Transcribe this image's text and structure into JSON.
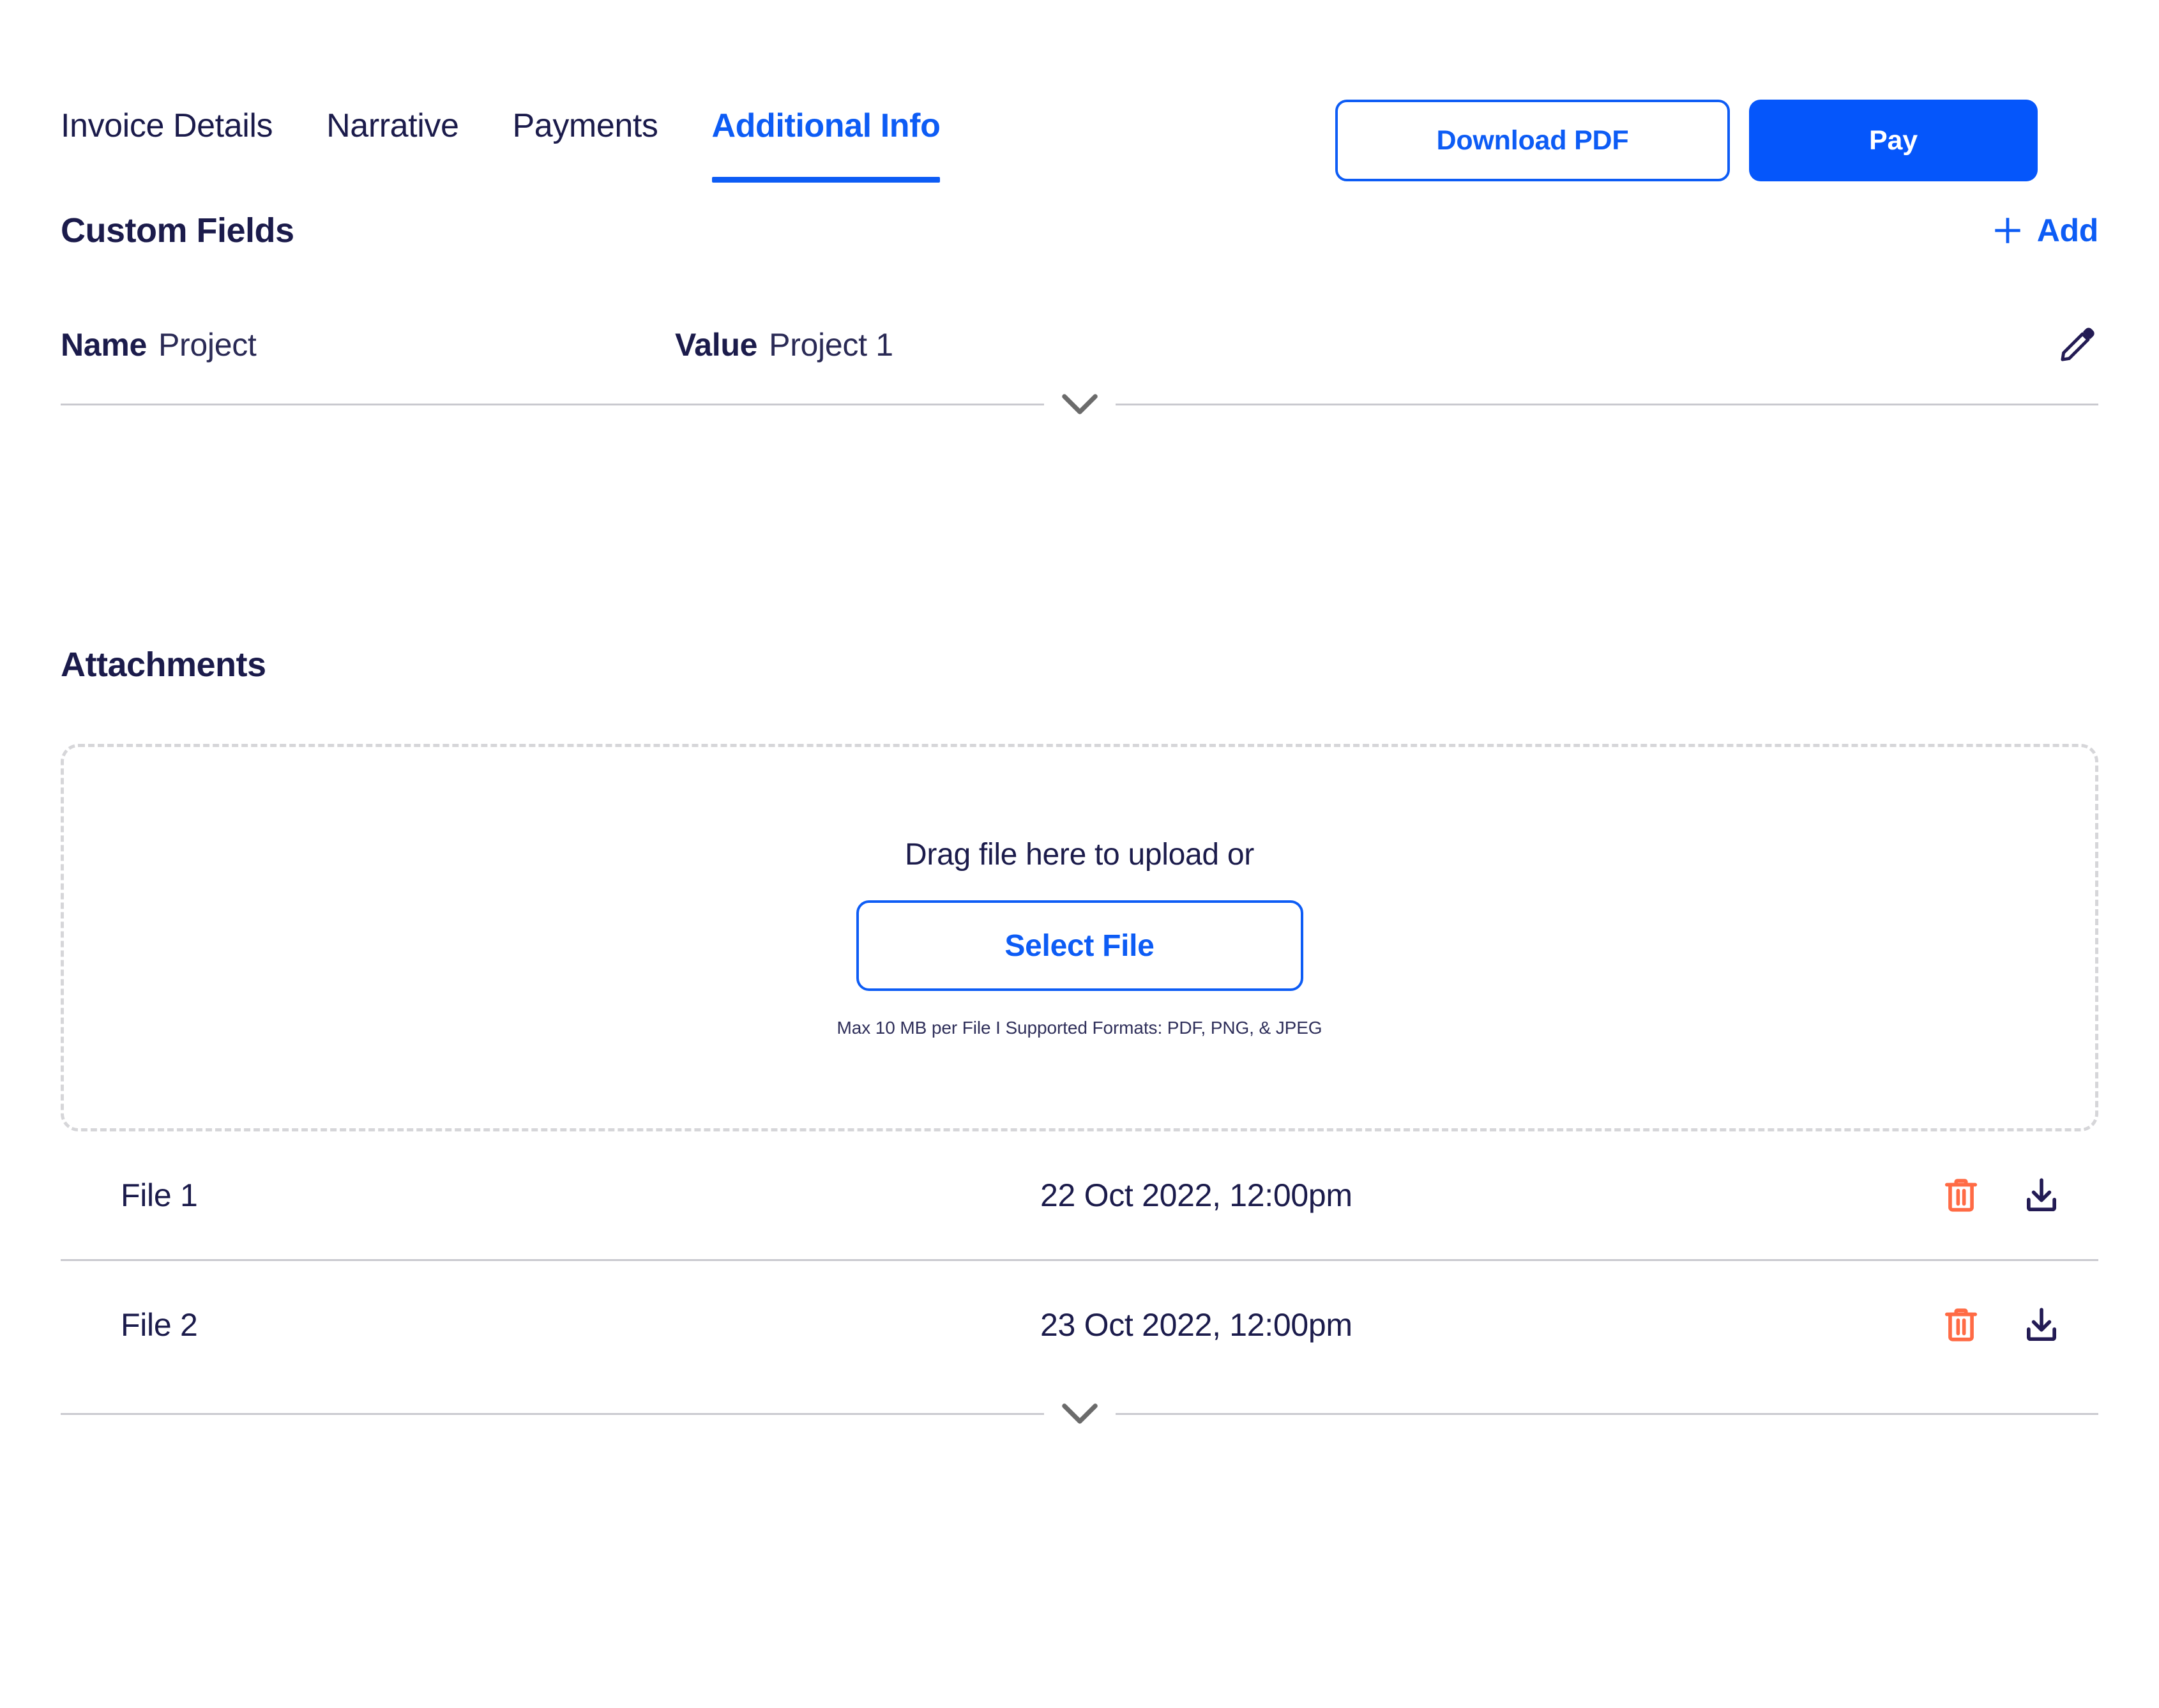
{
  "theme": {
    "accent_blue": "#0D5CF5",
    "primary_blue": "#0556FB",
    "navy": "#1B1B4B",
    "rule_gray": "#C9C9CF",
    "dash_gray": "#D6D6D9",
    "trash_orange": "#FF6B45"
  },
  "tabs": [
    {
      "label": "Invoice Details",
      "active": false
    },
    {
      "label": "Narrative",
      "active": false
    },
    {
      "label": "Payments",
      "active": false
    },
    {
      "label": "Additional Info",
      "active": true
    }
  ],
  "header_actions": {
    "download_pdf_label": "Download PDF",
    "pay_label": "Pay"
  },
  "custom_fields": {
    "title": "Custom Fields",
    "add_label": "Add",
    "rows": [
      {
        "name_label": "Name",
        "name_value": "Project",
        "value_label": "Value",
        "value_value": "Project 1"
      }
    ]
  },
  "attachments": {
    "title": "Attachments",
    "dropzone": {
      "prompt": "Drag file here to upload or",
      "select_label": "Select File",
      "note": "Max 10 MB per File  I  Supported Formats: PDF, PNG, & JPEG"
    },
    "files": [
      {
        "name": "File 1",
        "date": "22 Oct 2022, 12:00pm"
      },
      {
        "name": "File 2",
        "date": "23 Oct 2022, 12:00pm"
      }
    ]
  }
}
